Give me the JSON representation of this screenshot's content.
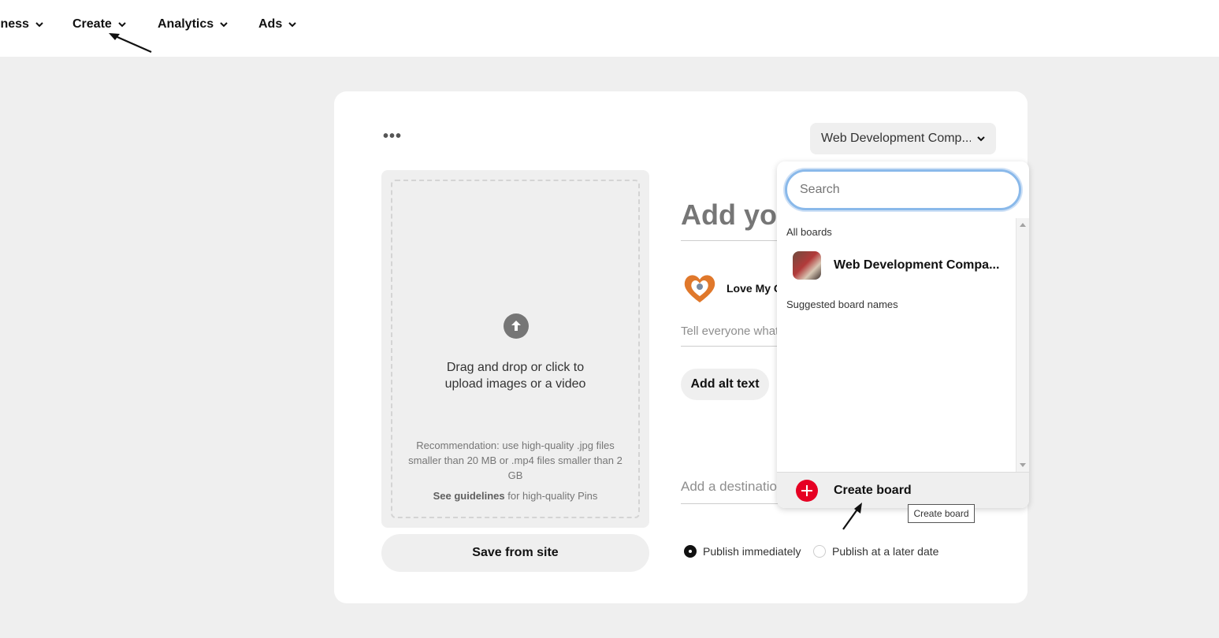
{
  "nav": {
    "items": [
      {
        "label": "iness"
      },
      {
        "label": "Create"
      },
      {
        "label": "Analytics"
      },
      {
        "label": "Ads"
      }
    ]
  },
  "card": {
    "more_label": "•••",
    "board_select": "Web Development Comp...",
    "upload": {
      "main_text": "Drag and drop or click to upload images or a video",
      "recommendation": "Recommendation: use high-quality .jpg files smaller than 20 MB or .mp4 files smaller than 2 GB",
      "guide_bold": "See guidelines",
      "guide_rest": " for high-quality Pins"
    },
    "save_site": "Save from site",
    "title_placeholder": "Add your title",
    "user_name": "Love My Co",
    "desc_placeholder": "Tell everyone what",
    "alt_text_button": "Add alt text",
    "dest_placeholder": "Add a destination",
    "publish_now": "Publish immediately",
    "publish_later": "Publish at a later date"
  },
  "dropdown": {
    "search_placeholder": "Search",
    "all_boards": "All boards",
    "board_name": "Web Development Compa...",
    "suggested": "Suggested board names",
    "create_board": "Create board",
    "tooltip": "Create board"
  },
  "colors": {
    "accent_red": "#e60023",
    "focus_blue": "#8ab9ea",
    "avatar_orange": "#e0782b"
  }
}
